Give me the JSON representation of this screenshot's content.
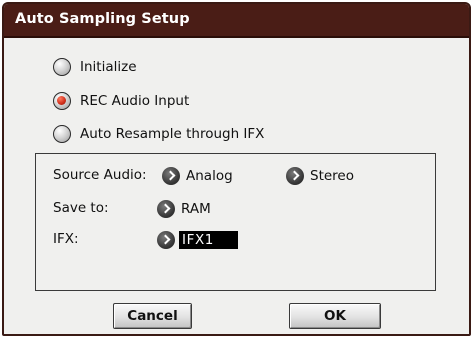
{
  "dialog": {
    "title": "Auto Sampling Setup"
  },
  "modes": [
    {
      "label": "Initialize",
      "selected": false
    },
    {
      "label": "REC Audio Input",
      "selected": true
    },
    {
      "label": "Auto Resample through IFX",
      "selected": false
    }
  ],
  "params": {
    "source_audio": {
      "label": "Source Audio:",
      "input_value": "Analog",
      "channel_value": "Stereo"
    },
    "save_to": {
      "label": "Save to:",
      "value": "RAM"
    },
    "ifx": {
      "label": "IFX:",
      "value": "IFX1"
    }
  },
  "buttons": {
    "cancel_label": "Cancel",
    "ok_label": "OK"
  },
  "colors": {
    "titlebar": "#4a1d16",
    "selected_radio": "#d4321e",
    "value_highlight": "#000000"
  },
  "icons": {
    "popup": "chevron-right-icon",
    "radio": "radio-button-icon"
  }
}
